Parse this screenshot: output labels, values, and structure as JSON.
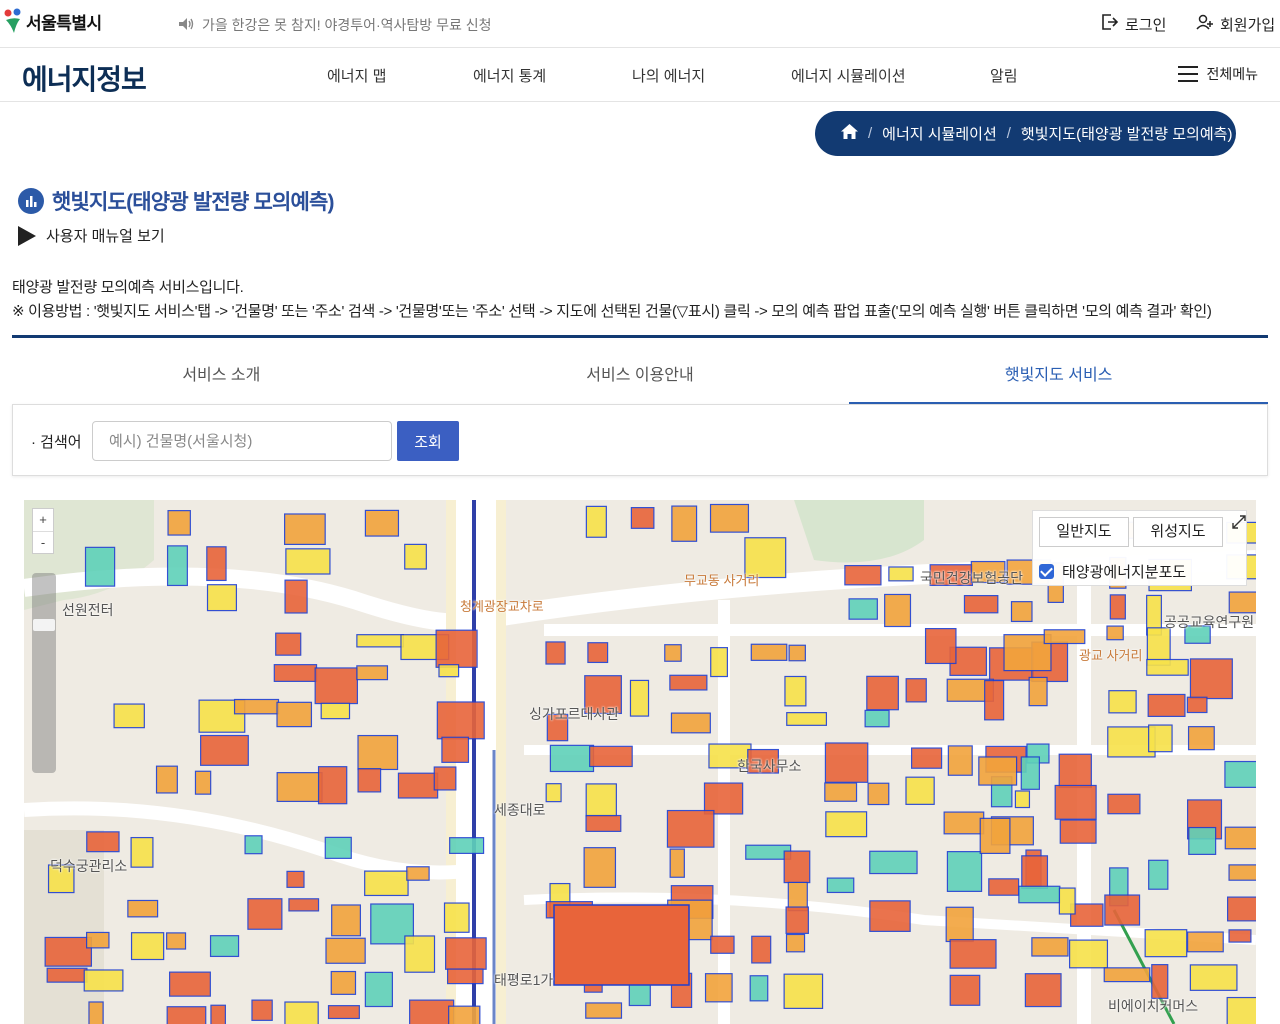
{
  "header": {
    "logo_text": "서울특별시",
    "notice": "가을 한강은 못 참지! 야경투어·역사탐방 무료 신청",
    "login": "로그인",
    "signup": "회원가입"
  },
  "gnb": {
    "site_title": "에너지정보",
    "menu": [
      "에너지 맵",
      "에너지 통계",
      "나의 에너지",
      "에너지 시뮬레이션",
      "알림"
    ],
    "all_menu": "전체메뉴"
  },
  "breadcrumb": {
    "items": [
      "에너지 시뮬레이션",
      "햇빛지도(태양광 발전량 모의예측)"
    ],
    "separator": "/"
  },
  "page": {
    "title": "햇빛지도(태양광 발전량 모의예측)",
    "manual_link": "사용자 매뉴얼 보기",
    "desc_line1": "태양광 발전량 모의예측 서비스입니다.",
    "desc_line2": "※ 이용방법 : '햇빛지도 서비스'탭 -> '건물명' 또는 '주소' 검색 -> '건물명'또는 '주소' 선택 -> 지도에 선택된 건물(▽표시) 클릭 -> 모의 예측 팝업 표출('모의 예측 실행' 버튼 클릭하면 '모의 예측 결과' 확인)"
  },
  "tabs": {
    "items": [
      "서비스 소개",
      "서비스 이용안내",
      "햇빛지도 서비스"
    ],
    "active_index": 2
  },
  "search": {
    "label": "검색어",
    "placeholder": "예시) 건물명(서울시청)",
    "value": "",
    "button": "조회"
  },
  "map": {
    "zoom_in": "+",
    "zoom_out": "-",
    "type_normal": "일반지도",
    "type_satellite": "위성지도",
    "layer_label": "태양광에너지분포도",
    "layer_checked": true,
    "labels": {
      "l1": "선원전터",
      "l2": "덕수궁관리소",
      "l3": "싱가포르대사관",
      "l4": "한국사무소",
      "l5": "무교동 사거리",
      "l6": "광교 사거리",
      "l7": "국민건강보험공단",
      "l8": "공공교육연구원",
      "l9": "비에이치커머스",
      "l10": "청계광장교차로",
      "l11": "태평로1가",
      "l12": "세종대로"
    },
    "colors": {
      "hot": "#e8643a",
      "warm": "#f2a43c",
      "mid": "#f7e24a",
      "cool": "#5fd1b9",
      "cold": "#2f63d8",
      "outline": "#1f3fd0"
    }
  },
  "colors": {
    "navy": "#123a72",
    "accent": "#2b5fb3",
    "button": "#3b5fc2"
  }
}
